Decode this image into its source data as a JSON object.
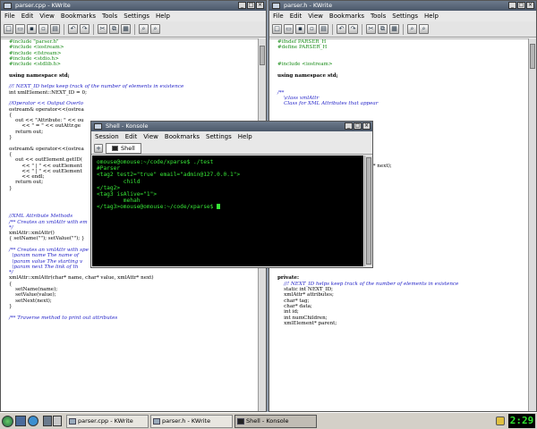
{
  "left_window": {
    "title": "parser.cpp - KWrite",
    "menu": [
      "File",
      "Edit",
      "View",
      "Bookmarks",
      "Tools",
      "Settings",
      "Help"
    ],
    "code": [
      {
        "t": "#include \"parser.h\"",
        "c": "pp"
      },
      {
        "t": "#include <iostream>",
        "c": "pp"
      },
      {
        "t": "#include <fstream>",
        "c": "pp"
      },
      {
        "t": "#include <stdio.h>",
        "c": "pp"
      },
      {
        "t": "#include <stdlib.h>",
        "c": "pp"
      },
      {
        "t": "",
        "c": ""
      },
      {
        "t": "using namespace std;",
        "c": "kw"
      },
      {
        "t": "",
        "c": ""
      },
      {
        "t": "//! NEXT_ID helps keep track of the number of elements in existence",
        "c": "cm"
      },
      {
        "t": "int xmlElement::NEXT_ID = 0;",
        "c": ""
      },
      {
        "t": "",
        "c": ""
      },
      {
        "t": "//Operator << Output Overlo",
        "c": "cm"
      },
      {
        "t": "ostream& operator<<(ostrea",
        "c": ""
      },
      {
        "t": "{",
        "c": ""
      },
      {
        "t": "    out << \"Attribute: \" << ou",
        "c": ""
      },
      {
        "t": "        << \" = \" << outAttr.ge",
        "c": ""
      },
      {
        "t": "    return out;",
        "c": ""
      },
      {
        "t": "}",
        "c": ""
      },
      {
        "t": "",
        "c": ""
      },
      {
        "t": "ostream& operator<<(ostrea",
        "c": ""
      },
      {
        "t": "{",
        "c": ""
      },
      {
        "t": "    out << outElement.getID(",
        "c": ""
      },
      {
        "t": "        << \" | \" << outElement",
        "c": ""
      },
      {
        "t": "        << \" | \" << outElement",
        "c": ""
      },
      {
        "t": "        << endl;",
        "c": ""
      },
      {
        "t": "    return out;",
        "c": ""
      },
      {
        "t": "}",
        "c": ""
      },
      {
        "t": "",
        "c": ""
      },
      {
        "t": "",
        "c": ""
      },
      {
        "t": "",
        "c": ""
      },
      {
        "t": "",
        "c": ""
      },
      {
        "t": "//XML Attribute Methods",
        "c": "cm"
      },
      {
        "t": "/** Creates an xmlAttr with em",
        "c": "cm"
      },
      {
        "t": "*/",
        "c": "cm"
      },
      {
        "t": "xmlAttr::xmlAttr()",
        "c": ""
      },
      {
        "t": "{ setName(\"\"); setValue(\"\"); }",
        "c": ""
      },
      {
        "t": "",
        "c": ""
      },
      {
        "t": "/** Creates an xmlAttr with spe",
        "c": "cm"
      },
      {
        "t": "  \\param name The name of",
        "c": "cm"
      },
      {
        "t": "  \\param value The starting v",
        "c": "cm"
      },
      {
        "t": "  \\param next The link of th",
        "c": "cm"
      },
      {
        "t": "*/",
        "c": "cm"
      },
      {
        "t": "xmlAttr::xmlAttr(char* name, char* value, xmlAttr* next)",
        "c": ""
      },
      {
        "t": "{",
        "c": ""
      },
      {
        "t": "    setName(name);",
        "c": ""
      },
      {
        "t": "    setValue(value);",
        "c": ""
      },
      {
        "t": "    setNext(next);",
        "c": ""
      },
      {
        "t": "}",
        "c": ""
      },
      {
        "t": "",
        "c": ""
      },
      {
        "t": "/** Traverse method to print out attributes",
        "c": "cm"
      }
    ]
  },
  "right_window": {
    "title": "parser.h - KWrite",
    "menu": [
      "File",
      "Edit",
      "View",
      "Bookmarks",
      "Tools",
      "Settings",
      "Help"
    ],
    "code": [
      {
        "t": "#ifndef PARSER_H",
        "c": "pp"
      },
      {
        "t": "#define PARSER_H",
        "c": "pp"
      },
      {
        "t": "",
        "c": ""
      },
      {
        "t": "",
        "c": ""
      },
      {
        "t": "#include <iostream>",
        "c": "pp"
      },
      {
        "t": "",
        "c": ""
      },
      {
        "t": "using namespace std;",
        "c": "kw"
      },
      {
        "t": "",
        "c": ""
      },
      {
        "t": "",
        "c": ""
      },
      {
        "t": "/**",
        "c": "cm"
      },
      {
        "t": "    \\class xmlAttr",
        "c": "cm"
      },
      {
        "t": "    Class for XML Attributes that appear",
        "c": "cm"
      },
      {
        "t": "",
        "c": ""
      },
      {
        "t": "",
        "c": ""
      },
      {
        "t": "",
        "c": ""
      },
      {
        "t": "",
        "c": ""
      },
      {
        "t": "",
        "c": ""
      },
      {
        "t": "",
        "c": ""
      },
      {
        "t": "",
        "c": ""
      },
      {
        "t": "",
        "c": ""
      },
      {
        "t": "",
        "c": ""
      },
      {
        "t": "",
        "c": ""
      },
      {
        "t": "                                                xmlAttr* next);",
        "c": ""
      },
      {
        "t": "",
        "c": ""
      },
      {
        "t": "",
        "c": ""
      },
      {
        "t": "",
        "c": ""
      },
      {
        "t": "",
        "c": ""
      },
      {
        "t": "",
        "c": ""
      },
      {
        "t": "",
        "c": ""
      },
      {
        "t": "",
        "c": ""
      },
      {
        "t": "",
        "c": ""
      },
      {
        "t": "",
        "c": ""
      },
      {
        "t": "",
        "c": ""
      },
      {
        "t": "",
        "c": ""
      },
      {
        "t": "",
        "c": ""
      },
      {
        "t": "",
        "c": ""
      },
      {
        "t": "",
        "c": ""
      },
      {
        "t": "",
        "c": ""
      },
      {
        "t": "",
        "c": ""
      },
      {
        "t": "",
        "c": ""
      },
      {
        "t": "",
        "c": ""
      },
      {
        "t": "",
        "c": ""
      },
      {
        "t": "private:",
        "c": "kw"
      },
      {
        "t": "    //! NEXT_ID helps keep track of the number of elements in existence",
        "c": "cm"
      },
      {
        "t": "    static int NEXT_ID;",
        "c": ""
      },
      {
        "t": "    xmlAttr* attributes;",
        "c": ""
      },
      {
        "t": "    char* tag;",
        "c": ""
      },
      {
        "t": "    char* data;",
        "c": ""
      },
      {
        "t": "    int id;",
        "c": ""
      },
      {
        "t": "    int numChildren;",
        "c": ""
      },
      {
        "t": "    xmlElement* parent;",
        "c": ""
      }
    ]
  },
  "shell": {
    "title": "Shell - Konsole",
    "menu": [
      "Session",
      "Edit",
      "View",
      "Bookmarks",
      "Settings",
      "Help"
    ],
    "tab_label": "Shell",
    "lines": [
      "omouse@omouse:~/code/xparse$ ./test",
      "#Parser",
      "<tag2 test2=\"true\" email=\"admin@127.0.0.1\">",
      "        child",
      "</tag2>",
      "<tag3 isAlive=\"1\">",
      "        mehah",
      "</tag3>omouse@omouse:~/code/xparse$ "
    ]
  },
  "taskbar": {
    "tasks": [
      "parser.cpp - KWrite",
      "parser.h - KWrite",
      "Shell - Konsole"
    ],
    "clock": "2:29"
  },
  "colors": {
    "terminal_text": "#37e637",
    "preprocessor": "#158a15",
    "comment": "#2424c8",
    "clock_text": "#2fe32f"
  }
}
